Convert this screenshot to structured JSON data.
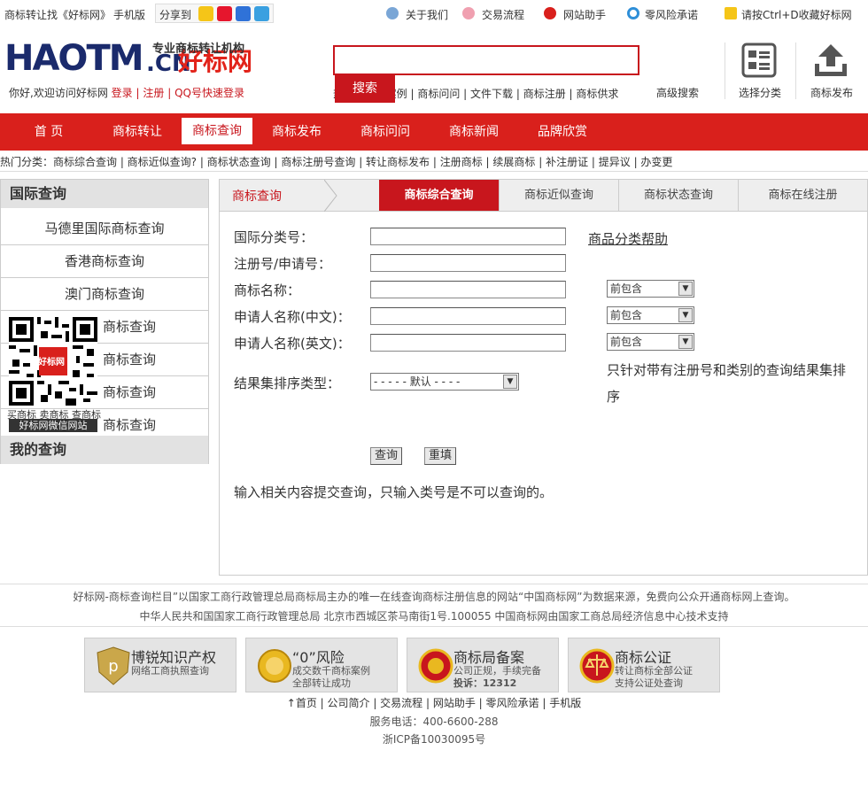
{
  "topbar": {
    "brand_text": "商标转让找《好标网》",
    "mobile": "手机版",
    "share_label": "分享到",
    "share_icons": [
      "qzone-icon",
      "weibo-icon",
      "baidu-icon",
      "pengyou-icon"
    ],
    "links": [
      "关于我们",
      "交易流程",
      "网站助手",
      "零风险承诺"
    ],
    "bookmark": "请按Ctrl+D收藏好标网"
  },
  "header": {
    "logo_main": "HAOTM",
    "logo_cn": ".CN",
    "logo_hb": "好标网",
    "logo_sub": "专业商标转让机构",
    "welcome": "你好,欢迎访问好标网",
    "login": "登录",
    "register": "注册",
    "qq_login": "QQ号快速登录",
    "search_placeholder": "",
    "search_button": "搜索",
    "hotlinks": "热门 | 成功案例 | 商标问问 | 文件下载 | 商标注册 | 商标供求",
    "advanced_search": "高级搜索",
    "select_class": "选择分类",
    "publish": "商标发布"
  },
  "nav": {
    "items": [
      "首 页",
      "商标转让",
      "商标查询",
      "商标发布",
      "商标问问",
      "商标新闻",
      "品牌欣赏"
    ],
    "active_index": 2
  },
  "hotcats": "热门分类：商标综合查询 | 商标近似查询? | 商标状态查询 | 商标注册号查询 | 转让商标发布 | 注册商标 | 续展商标 | 补注册证 | 提异议 | 办变更",
  "sidebar": {
    "head1": "国际查询",
    "items": [
      "马德里国际商标查询",
      "香港商标查询",
      "澳门商标查询",
      "商标查询",
      "商标查询",
      "商标查询",
      "商标查询"
    ],
    "head2": "我的查询",
    "qr_caption": "买商标 卖商标 查商标",
    "qr_label": "好标网微信网站",
    "qr_logo": "好标网"
  },
  "main": {
    "breadcrumb": "商标查询",
    "tabs": [
      "商标综合查询",
      "商标近似查询",
      "商标状态查询",
      "商标在线注册"
    ],
    "form": {
      "class_label": "国际分类号：",
      "class_help": "商品分类帮助",
      "regno_label": "注册号/申请号：",
      "name_label": "商标名称：",
      "applicant_cn_label": "申请人名称(中文)：",
      "applicant_en_label": "申请人名称(英文)：",
      "sort_label": "结果集排序类型：",
      "match_option": "前包含",
      "sort_option": "- - - - - 默认 - - - -",
      "sort_note": "只针对带有注册号和类别的查询结果集排序",
      "submit": "查询",
      "reset": "重填",
      "hint": "输入相关内容提交查询，只输入类号是不可以查询的。"
    }
  },
  "footer": {
    "line1": "好标网-商标查询栏目”以国家工商行政管理总局商标局主办的唯一在线查询商标注册信息的网站“中国商标网”为数据来源，免费向公众开通商标网上查询。",
    "line2": "中华人民共和国国家工商行政管理总局 北京市西城区茶马南街1号.100055 中国商标网由国家工商总局经济信息中心技术支持",
    "badges": [
      {
        "title": "博锐知识产权",
        "sub1": "网络工商执照查询",
        "sub2": ""
      },
      {
        "title": "“0”风险",
        "sub1": "成交数千商标案例",
        "sub2": "全部转让成功"
      },
      {
        "title": "商标局备案",
        "sub1": "公司正规，手续完备",
        "sub2": "投诉：12312"
      },
      {
        "title": "商标公证",
        "sub1": "转让商标全部公证",
        "sub2": "支持公证处查询"
      }
    ],
    "links": "↑首页 | 公司简介 | 交易流程 | 网站助手 | 零风险承诺 | 手机版",
    "phone": "服务电话：400-6600-288",
    "icp": "浙ICP备10030095号"
  }
}
